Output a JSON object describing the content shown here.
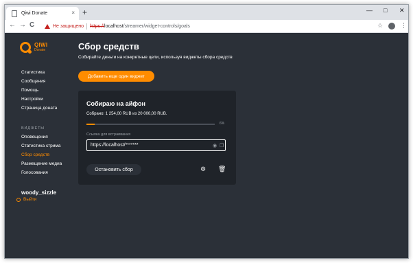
{
  "browser": {
    "tab_title": "Qiwi Donate",
    "tab_close": "×",
    "new_tab": "+",
    "window_controls": {
      "minimize": "—",
      "maximize": "□",
      "close": "✕"
    },
    "nav": {
      "back": "←",
      "forward": "→",
      "reload": "C"
    },
    "security_label": "Не защищено",
    "url_scheme": "https://",
    "url_host": "localhost",
    "url_path": "/streamer/widget-controls/goals",
    "star": "☆",
    "menu": "⋮"
  },
  "logo": {
    "main": "QIWI",
    "sub": "Donate"
  },
  "sidebar": {
    "items": [
      {
        "label": "Статистика"
      },
      {
        "label": "Сообщения"
      },
      {
        "label": "Помощь"
      },
      {
        "label": "Настройки"
      },
      {
        "label": "Страница доната"
      }
    ],
    "widgets_heading": "ВИДЖЕТЫ",
    "widgets": [
      {
        "label": "Оповещения"
      },
      {
        "label": "Статистика стрима"
      },
      {
        "label": "Сбор средств"
      },
      {
        "label": "Размещение медиа"
      },
      {
        "label": "Голосования"
      }
    ],
    "active_widget": "Сбор средств",
    "username": "woody_sizzle",
    "logout": "Выйти"
  },
  "main": {
    "title": "Сбор средств",
    "subtitle": "Собирайте деньги на конкретные цели, используя виджеты сбора средств",
    "add_button": "Добавить еще один виджет",
    "goal": {
      "title": "Собираю на айфон",
      "collected_text": "Собрано: 1 254,00 RUB из 20 000,00 RUB.",
      "progress_fraction": 0.0627,
      "progress_label": "6%",
      "embed_label": "Ссылка для встраивания",
      "embed_value": "https://localhost/*******",
      "stop_button": "Остановить сбор"
    }
  },
  "colors": {
    "accent": "#ff8c00",
    "background": "#2b3038",
    "card": "#1f2329"
  }
}
